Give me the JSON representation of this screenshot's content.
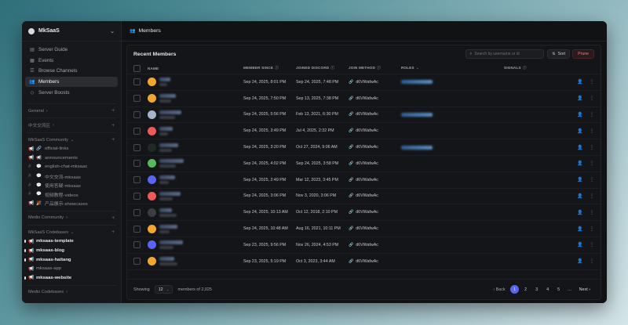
{
  "server": {
    "name": "MkSaaS"
  },
  "sidebar": {
    "nav": [
      {
        "label": "Server Guide",
        "icon": "book-icon"
      },
      {
        "label": "Events",
        "icon": "calendar-icon"
      },
      {
        "label": "Browse Channels",
        "icon": "list-icon"
      },
      {
        "label": "Members",
        "icon": "members-icon",
        "active": true
      },
      {
        "label": "Server Boosts",
        "icon": "boost-icon"
      }
    ],
    "sections": {
      "general": "General",
      "cn": "中文交流区",
      "community": "MkSaaS Community",
      "medio": "Medio Community",
      "codebases": "MkSaaS Codebases",
      "medio_codebases": "Medio Codebases"
    },
    "community_channels": [
      {
        "emoji": "🔗",
        "name": "official-links"
      },
      {
        "emoji": "📢",
        "name": "announcements"
      },
      {
        "emoji": "💬",
        "name": "english-chat-mksaas"
      },
      {
        "emoji": "💬",
        "name": "中文交流-mksaas"
      },
      {
        "emoji": "💬",
        "name": "使用答疑-mksaas"
      },
      {
        "emoji": "💬",
        "name": "视频教程-videos"
      },
      {
        "emoji": "🎉",
        "name": "产品展示-showcases"
      }
    ],
    "codebase_channels": [
      {
        "name": "mksaas-template",
        "bold": true
      },
      {
        "name": "mksaas-blog",
        "bold": true
      },
      {
        "name": "mksaas-haitang",
        "bold": true
      },
      {
        "name": "mksaas-app",
        "bold": false
      },
      {
        "name": "mksaas-website",
        "bold": true
      }
    ]
  },
  "header": {
    "title": "Members"
  },
  "panel": {
    "title": "Recent Members",
    "search_placeholder": "Search by username or id",
    "sort_label": "Sort",
    "prune_label": "Prune"
  },
  "table": {
    "columns": {
      "name": "NAME",
      "since": "MEMBER SINCE",
      "joined": "JOINED DISCORD",
      "method": "JOIN METHOD",
      "roles": "ROLES",
      "signals": "SIGNALS"
    },
    "rows": [
      {
        "avatar_color": "#f0a732",
        "since": "Sep 24, 2025, 8:01 PM",
        "joined": "Sep 24, 2025, 7:48 PM",
        "method": "d6VWafwAc",
        "role": true
      },
      {
        "avatar_color": "#f0a732",
        "since": "Sep 24, 2025, 7:50 PM",
        "joined": "Sep 13, 2025, 7:38 PM",
        "method": "d6VWafwAc",
        "role": false
      },
      {
        "avatar_color": "#a9b3c7",
        "since": "Sep 24, 2025, 5:56 PM",
        "joined": "Feb 13, 2021, 6:30 PM",
        "method": "d6VWafwAc",
        "role": true
      },
      {
        "avatar_color": "#ee5a5a",
        "since": "Sep 24, 2025, 3:49 PM",
        "joined": "Jul 4, 2025, 2:32 PM",
        "method": "d6VWafwAc",
        "role": false
      },
      {
        "avatar_color": "#1f2a24",
        "since": "Sep 24, 2025, 3:20 PM",
        "joined": "Oct 27, 2024, 9:06 AM",
        "method": "d6VWafwAc",
        "role": true
      },
      {
        "avatar_color": "#58b85c",
        "since": "Sep 24, 2025, 4:02 PM",
        "joined": "Sep 24, 2025, 3:58 PM",
        "method": "d6VWafwAc",
        "role": false
      },
      {
        "avatar_color": "#5865f2",
        "since": "Sep 24, 2025, 2:49 PM",
        "joined": "Mar 12, 2023, 3:45 PM",
        "method": "d6VWafwAc",
        "role": false
      },
      {
        "avatar_color": "#ee5a5a",
        "since": "Sep 24, 2025, 3:06 PM",
        "joined": "Nov 3, 2020, 3:06 PM",
        "method": "d6VWafwAc",
        "role": false
      },
      {
        "avatar_color": "#3a3d44",
        "since": "Sep 24, 2025, 10:13 AM",
        "joined": "Oct 12, 2018, 2:10 PM",
        "method": "d6VWafwAc",
        "role": false
      },
      {
        "avatar_color": "#f0a732",
        "since": "Sep 24, 2025, 10:48 AM",
        "joined": "Aug 16, 2021, 10:11 PM",
        "method": "d6VWafwAc",
        "role": false
      },
      {
        "avatar_color": "#5865f2",
        "since": "Sep 23, 2025, 9:56 PM",
        "joined": "Nov 26, 2024, 4:53 PM",
        "method": "d6VWafwAc",
        "role": false
      },
      {
        "avatar_color": "#f0a732",
        "since": "Sep 23, 2025, 5:19 PM",
        "joined": "Oct 3, 2023, 3:44 AM",
        "method": "d6VWafwAc",
        "role": false
      }
    ]
  },
  "pagination": {
    "showing_label": "Showing",
    "per_page": "12",
    "total_label": "members of 2,025",
    "back_label": "Back",
    "next_label": "Next",
    "pages": [
      "1",
      "2",
      "3",
      "4",
      "5"
    ],
    "ellipsis": "…",
    "current": "1"
  }
}
